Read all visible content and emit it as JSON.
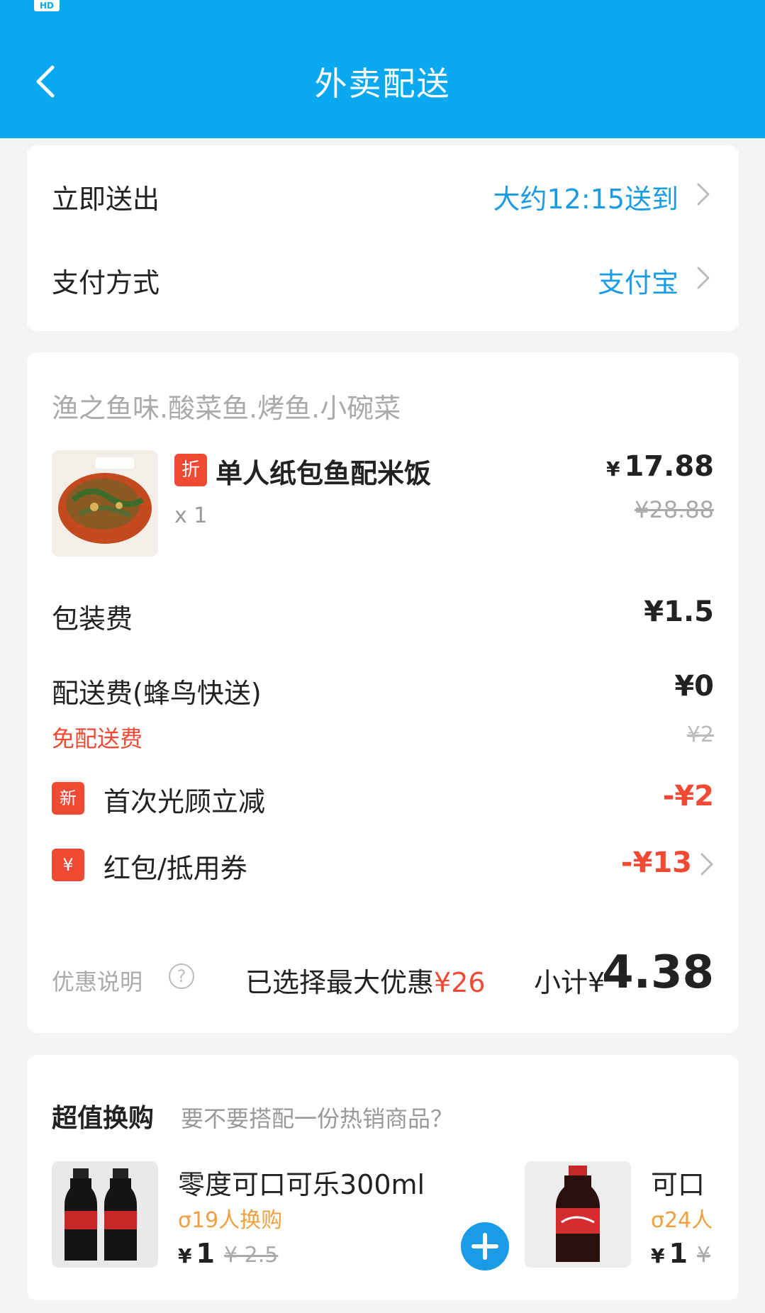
{
  "status_bar": {
    "hd_badge": "HD"
  },
  "header": {
    "title": "外卖配送"
  },
  "delivery": {
    "time_label": "立即送出",
    "time_value": "大约12:15送到",
    "payment_label": "支付方式",
    "payment_value": "支付宝"
  },
  "order": {
    "shop_name": "渔之鱼味.酸菜鱼.烤鱼.小碗菜",
    "item": {
      "tag": "折",
      "name": "单人纸包鱼配米饭",
      "qty": "x 1",
      "currency": "¥",
      "price": "17.88",
      "original_price": "¥28.88"
    },
    "packaging_label": "包装费",
    "packaging_value": "¥1.5",
    "delivery_fee_label": "配送费(蜂鸟快送)",
    "delivery_fee_value": "¥0",
    "free_delivery_note": "免配送费",
    "delivery_fee_original": "¥2",
    "promos": [
      {
        "icon": "新",
        "label": "首次光顾立减",
        "value": "-¥2"
      },
      {
        "icon": "¥",
        "label": "红包/抵用券",
        "value": "-¥13"
      }
    ],
    "discount_note_label": "优惠说明",
    "help_glyph": "?",
    "max_discount_text": "已选择最大优惠",
    "max_discount_value": "¥26",
    "subtotal_label": "小计¥",
    "subtotal_value": "4.38"
  },
  "upsell": {
    "title": "超值换购",
    "subtitle": "要不要搭配一份热销商品？",
    "products": [
      {
        "name": "零度可口可乐300ml",
        "buyers": "19人换购",
        "currency": "¥",
        "price": "1",
        "original_price": "¥ 2.5"
      },
      {
        "name": "可口",
        "buyers": "24人",
        "currency": "¥",
        "price": "1",
        "original_price": "¥"
      }
    ]
  },
  "colors": {
    "header": "#0aa8ee",
    "accent_blue": "#1a9be6",
    "accent_red": "#f04a35",
    "buyers_orange": "#f0a040"
  }
}
